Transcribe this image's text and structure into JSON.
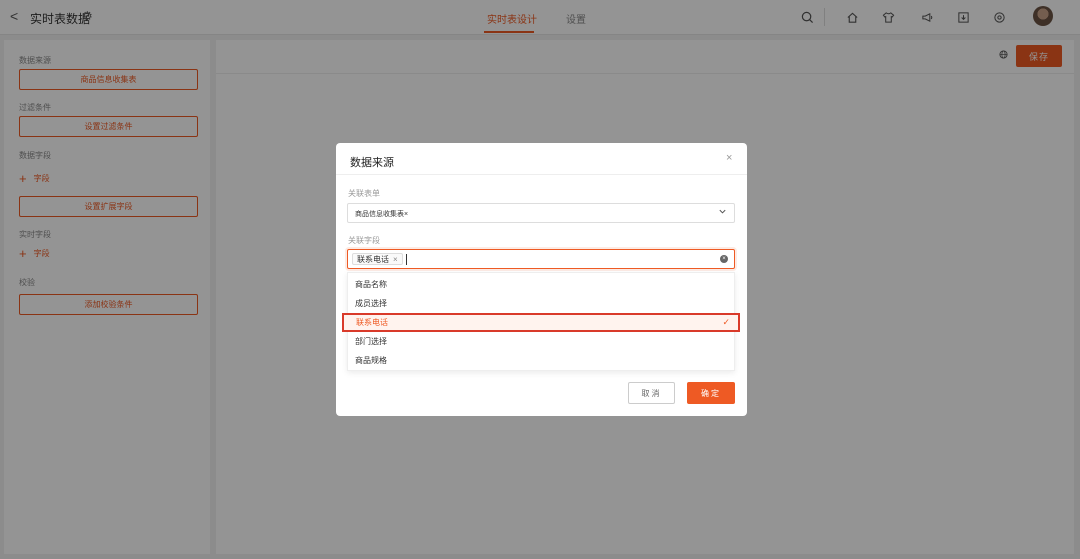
{
  "header": {
    "back_label": "<",
    "title": "实时表数据",
    "tabs": [
      {
        "label": "实时表设计",
        "active": true
      },
      {
        "label": "设置",
        "active": false
      }
    ],
    "icons": [
      "search-icon",
      "home-icon",
      "shirt-icon",
      "megaphone-icon",
      "download-icon",
      "record-icon"
    ]
  },
  "left_panel": {
    "data_source_label": "数据来源",
    "data_source_button": "商品信息收集表",
    "filter_label": "过滤条件",
    "filter_button": "设置过滤条件",
    "data_field_label": "数据字段",
    "add_field_1": "字段",
    "extend_field_button": "设置扩展字段",
    "realtime_field_label": "实时字段",
    "add_field_2": "字段",
    "validation_label": "校验",
    "validation_button": "添加校验条件"
  },
  "canvas": {
    "save_label": "保存"
  },
  "modal": {
    "title": "数据来源",
    "close_label": "×",
    "related_form_label": "关联表单",
    "related_form_value": "商品信息收集表",
    "related_form_remove": "×",
    "related_field_label": "关联字段",
    "selected_tag": "联系电话",
    "selected_tag_remove": "×",
    "options": [
      {
        "label": "商品名称",
        "selected": false
      },
      {
        "label": "成员选择",
        "selected": false
      },
      {
        "label": "联系电话",
        "selected": true
      },
      {
        "label": "部门选择",
        "selected": false
      },
      {
        "label": "商品规格",
        "selected": false
      }
    ],
    "check_mark": "✓",
    "cancel_label": "取消",
    "ok_label": "确定"
  },
  "colors": {
    "accent": "#ee5a24",
    "highlight_border": "#d93a2a"
  }
}
